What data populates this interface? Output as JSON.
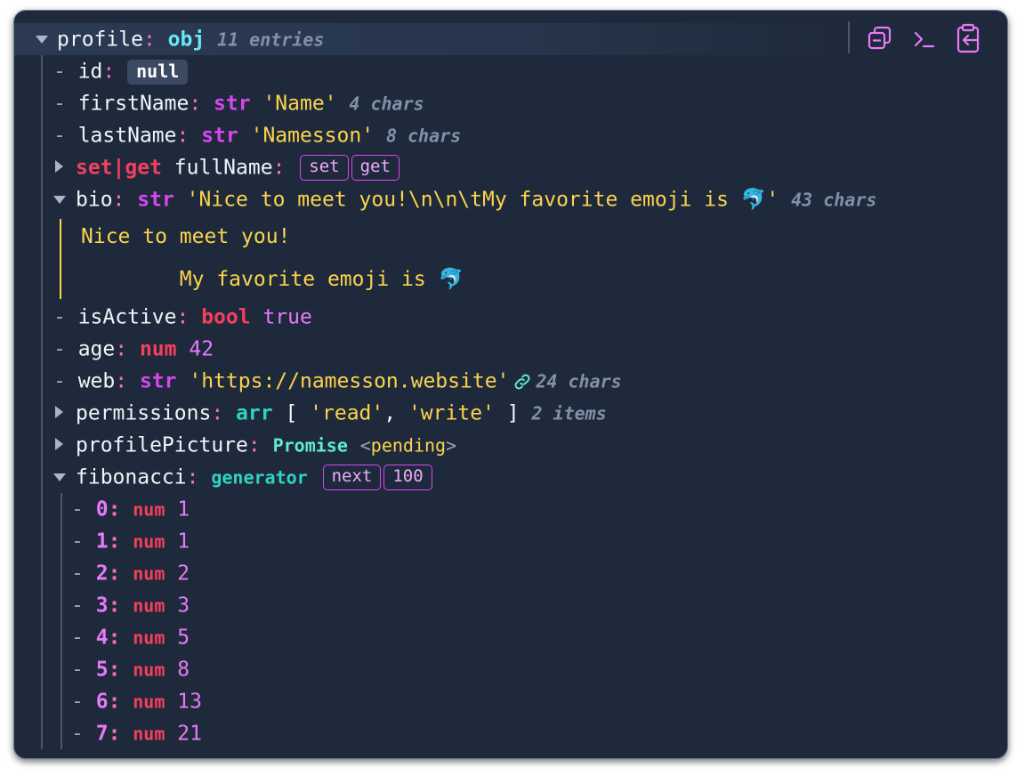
{
  "root": {
    "key": "profile",
    "type": "obj",
    "meta": "11 entries"
  },
  "toolbar": {
    "icons": [
      "collapse-all-icon",
      "console-icon",
      "clipboard-icon"
    ]
  },
  "rows": {
    "id": {
      "key": "id",
      "value": "null"
    },
    "firstName": {
      "key": "firstName",
      "type": "str",
      "value": "'Name'",
      "meta": "4 chars"
    },
    "lastName": {
      "key": "lastName",
      "type": "str",
      "value": "'Namesson'",
      "meta": "8 chars"
    },
    "fullName": {
      "prefix": "set|get",
      "key": "fullName",
      "buttons": [
        "set",
        "get"
      ]
    },
    "bio": {
      "key": "bio",
      "type": "str",
      "value": "'Nice to meet you!\\n\\n\\tMy favorite emoji is 🐬'",
      "meta": "43 chars",
      "lines": [
        "Nice to meet you!",
        "        My favorite emoji is 🐬"
      ]
    },
    "isActive": {
      "key": "isActive",
      "type": "bool",
      "value": "true"
    },
    "age": {
      "key": "age",
      "type": "num",
      "value": "42"
    },
    "web": {
      "key": "web",
      "type": "str",
      "value": "'https://namesson.website'",
      "meta": "24 chars"
    },
    "permissions": {
      "key": "permissions",
      "type": "arr",
      "open": "[",
      "items": [
        "'read'",
        "'write'"
      ],
      "close": "]",
      "meta": "2 items"
    },
    "profilePicture": {
      "key": "profilePicture",
      "type": "Promise",
      "state": "pending"
    },
    "fibonacci": {
      "key": "fibonacci",
      "type": "generator",
      "buttons": [
        "next",
        "100"
      ]
    }
  },
  "fib_items": [
    {
      "index": "0",
      "type": "num",
      "value": "1"
    },
    {
      "index": "1",
      "type": "num",
      "value": "1"
    },
    {
      "index": "2",
      "type": "num",
      "value": "2"
    },
    {
      "index": "3",
      "type": "num",
      "value": "3"
    },
    {
      "index": "4",
      "type": "num",
      "value": "5"
    },
    {
      "index": "5",
      "type": "num",
      "value": "8"
    },
    {
      "index": "6",
      "type": "num",
      "value": "13"
    },
    {
      "index": "7",
      "type": "num",
      "value": "21"
    }
  ]
}
